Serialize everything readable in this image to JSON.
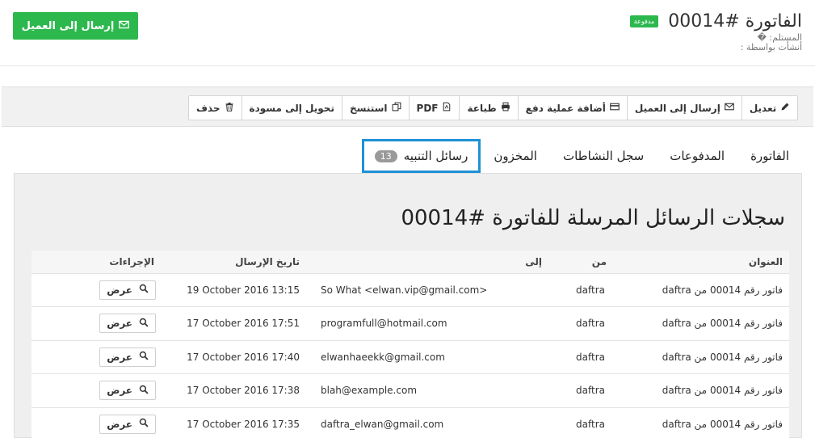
{
  "header": {
    "title": "الفاتورة #00014",
    "status_badge": "مدفوعة",
    "recipient_label": "المستلم: �",
    "created_by_label": "أنشأت بواسطة :",
    "send_to_client": "إرسال إلى العميل"
  },
  "toolbar": {
    "edit": "تعديل",
    "send_to_client": "إرسال إلى العميل",
    "add_payment": "أضافة عملية دفع",
    "print": "طباعة",
    "pdf": "PDF",
    "copy": "استنسخ",
    "convert_to_draft": "تحويل إلى مسودة",
    "delete": "حذف"
  },
  "tabs": {
    "invoice": "الفاتورة",
    "payments": "المدفوعات",
    "activity_log": "سجل النشاطات",
    "inventory": "المخزون",
    "notifications": "رسائل التنبيه",
    "notifications_count": "13"
  },
  "section": {
    "title": "سجلات الرسائل المرسلة للفاتورة #00014"
  },
  "table": {
    "headers": {
      "subject": "العنوان",
      "from": "من",
      "to": "إلى",
      "date": "تاريخ الإرسال",
      "actions": "الإجراءات"
    },
    "view_label": "عرض",
    "rows": [
      {
        "subject": "فاتور رقم 00014 من daftra",
        "from": "daftra",
        "to": "So What <elwan.vip@gmail.com>",
        "date": "19 October 2016 13:15"
      },
      {
        "subject": "فاتور رقم 00014 من daftra",
        "from": "daftra",
        "to": "programfull@hotmail.com",
        "date": "17 October 2016 17:51"
      },
      {
        "subject": "فاتور رقم 00014 من daftra",
        "from": "daftra",
        "to": "elwanhaeekk@gmail.com",
        "date": "17 October 2016 17:40"
      },
      {
        "subject": "فاتور رقم 00014 من daftra",
        "from": "daftra",
        "to": "blah@example.com",
        "date": "17 October 2016 17:38"
      },
      {
        "subject": "فاتور رقم 00014 من daftra",
        "from": "daftra",
        "to": "daftra_elwan@gmail.com",
        "date": "17 October 2016 17:35"
      }
    ]
  },
  "colors": {
    "accent_green": "#2db84e",
    "active_tab_border": "#1e91d6",
    "badge_gray": "#9a9a9a"
  },
  "icons": [
    "envelope-icon",
    "pencil-icon",
    "credit-card-icon",
    "print-icon",
    "pdf-file-icon",
    "copy-icon",
    "trash-icon",
    "search-icon"
  ]
}
